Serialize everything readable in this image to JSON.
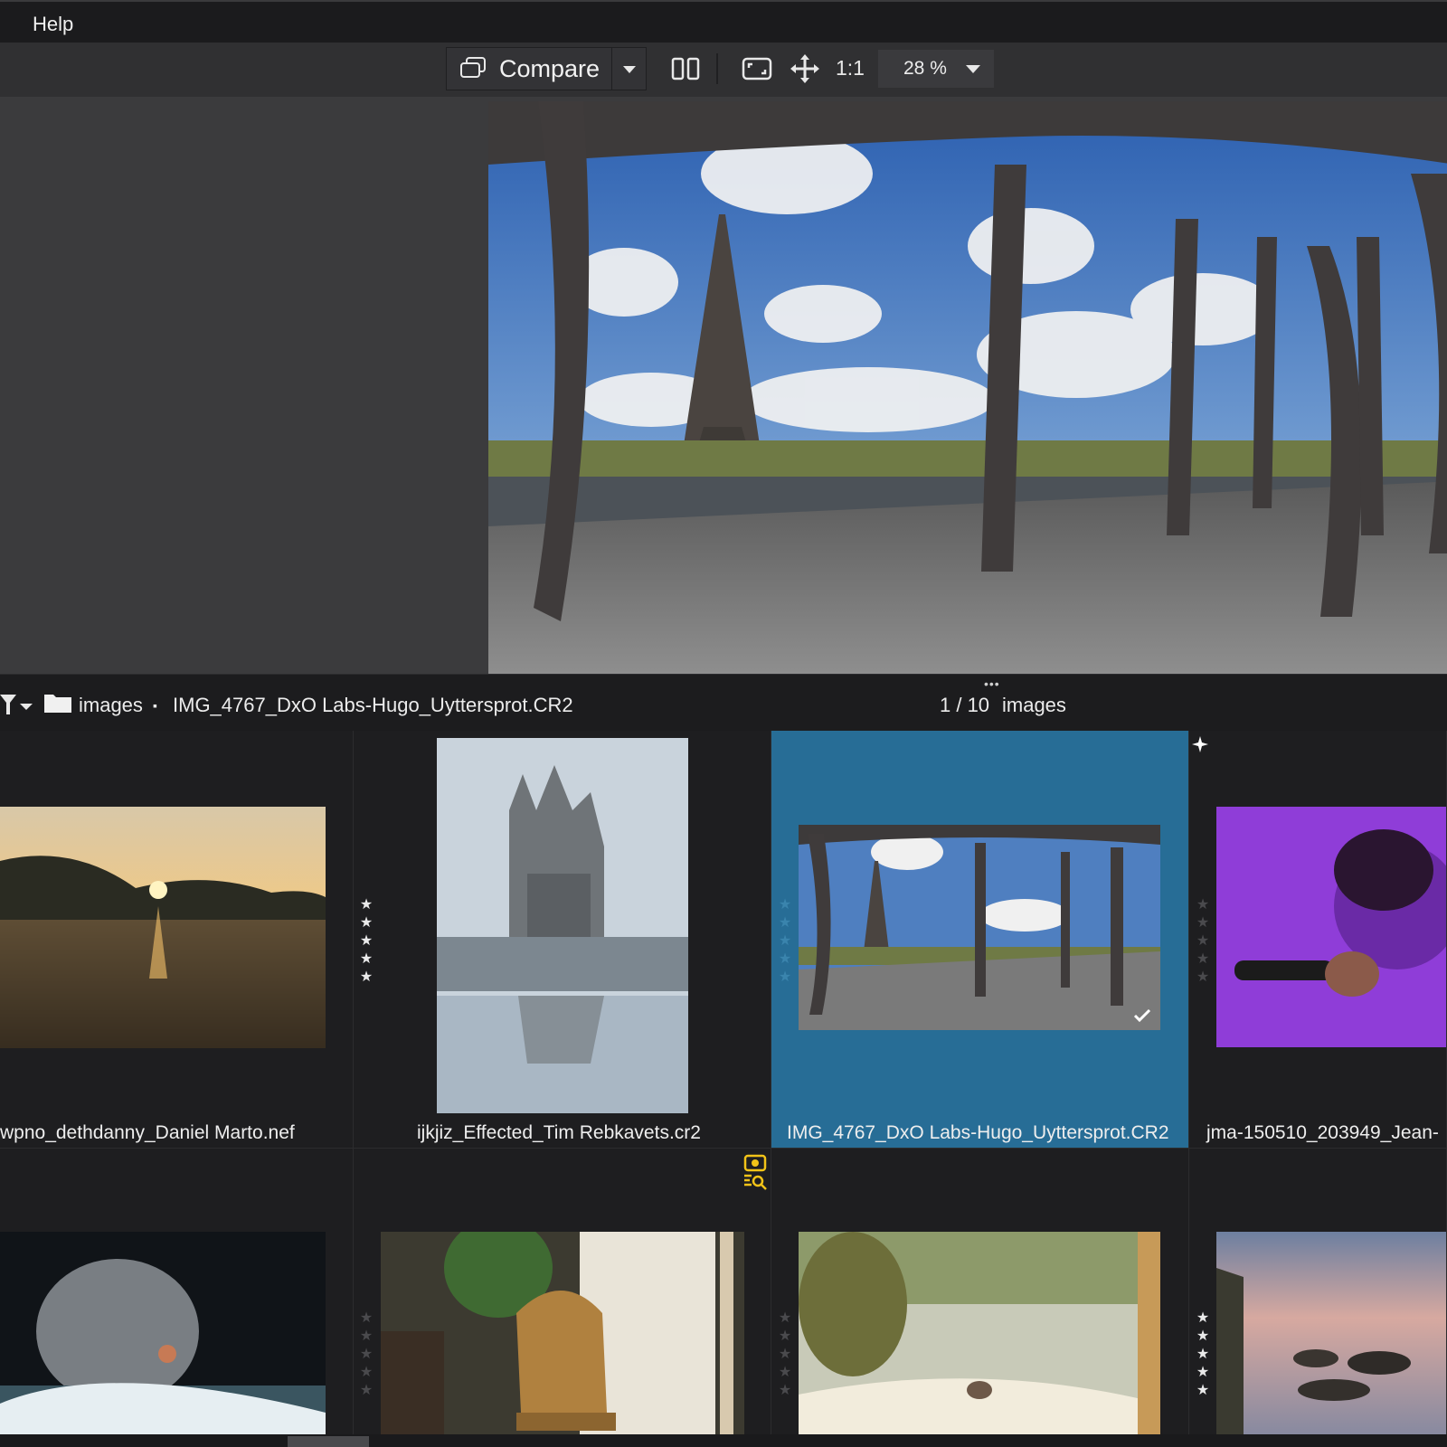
{
  "menu": {
    "help": "Help"
  },
  "toolbar": {
    "compare_label": "Compare",
    "ratio_label": "1:1",
    "zoom_value": "28 %"
  },
  "browser": {
    "folder": "images",
    "separator": "▪",
    "current_file": "IMG_4767_DxO Labs-Hugo_Uyttersprot.CR2",
    "counter": "1 / 10",
    "counter_suffix": "images"
  },
  "thumbnails": [
    {
      "name": "wpno_dethdanny_Daniel Marto.nef",
      "stars": 0,
      "selected": false
    },
    {
      "name": "ijkjiz_Effected_Tim Rebkavets.cr2",
      "stars": 5,
      "selected": false
    },
    {
      "name": "IMG_4767_DxO Labs-Hugo_Uyttersprot.CR2",
      "stars": 0,
      "selected": true
    },
    {
      "name": "jma-150510_203949_Jean-",
      "stars": 0,
      "selected": false
    },
    {
      "name": "",
      "stars": 0,
      "selected": false
    },
    {
      "name": "",
      "stars": 0,
      "selected": false
    },
    {
      "name": "",
      "stars": 0,
      "selected": false
    },
    {
      "name": "",
      "stars": 5,
      "selected": false
    }
  ],
  "colors": {
    "accent": "#276d96",
    "toolbar": "#303032",
    "viewer": "#3b3b3d",
    "badge": "#f2c318"
  }
}
